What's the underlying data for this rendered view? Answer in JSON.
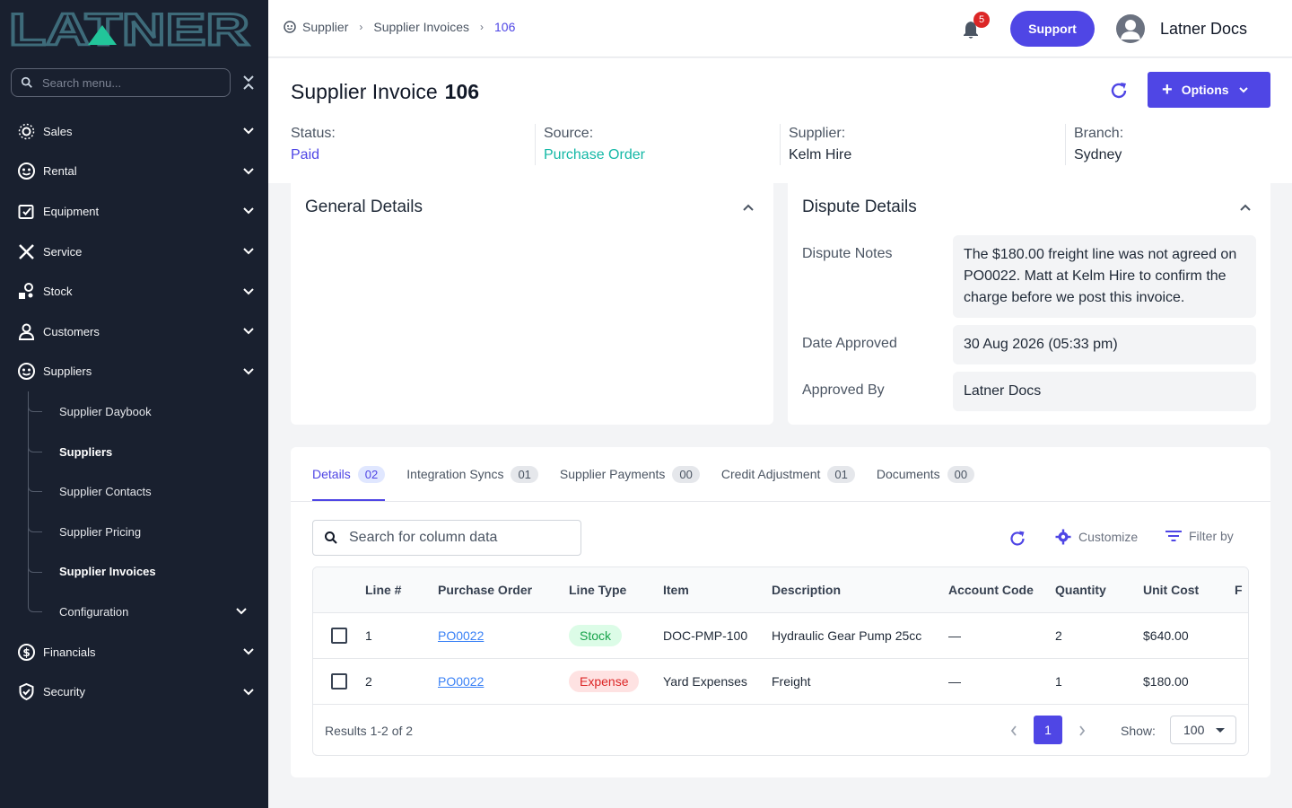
{
  "brand": {
    "logo_text": "LATNER"
  },
  "sidebar": {
    "search_placeholder": "Search menu...",
    "items": [
      {
        "label": "Sales",
        "icon": "sales-icon"
      },
      {
        "label": "Rental",
        "icon": "rental-icon"
      },
      {
        "label": "Equipment",
        "icon": "equipment-icon"
      },
      {
        "label": "Service",
        "icon": "service-icon"
      },
      {
        "label": "Stock",
        "icon": "stock-icon"
      },
      {
        "label": "Customers",
        "icon": "customers-icon"
      },
      {
        "label": "Suppliers",
        "icon": "suppliers-icon"
      },
      {
        "label": "Financials",
        "icon": "financials-icon"
      },
      {
        "label": "Security",
        "icon": "security-icon"
      }
    ],
    "supplier_subitems": [
      {
        "label": "Supplier Daybook",
        "active": false
      },
      {
        "label": "Suppliers",
        "active": true
      },
      {
        "label": "Supplier Contacts",
        "active": false
      },
      {
        "label": "Supplier Pricing",
        "active": false
      },
      {
        "label": "Supplier Invoices",
        "active": true
      },
      {
        "label": "Configuration",
        "active": false
      }
    ]
  },
  "topbar": {
    "breadcrumb": [
      "Supplier",
      "Supplier Invoices",
      "106"
    ],
    "notification_count": "5",
    "support_label": "Support",
    "user_name": "Latner Docs"
  },
  "header": {
    "title": "Supplier Invoice",
    "number": "106",
    "options_label": "Options",
    "meta": [
      {
        "label": "Status:",
        "value": "Paid"
      },
      {
        "label": "Source:",
        "value": "Purchase Order"
      },
      {
        "label": "Supplier:",
        "value": "Kelm Hire"
      },
      {
        "label": "Branch:",
        "value": "Sydney"
      }
    ]
  },
  "general_details": {
    "title": "General Details"
  },
  "dispute_details": {
    "title": "Dispute Details",
    "fields": [
      {
        "label": "Dispute Notes",
        "value": "The $180.00 freight line was not agreed on PO0022. Matt at Kelm Hire to confirm the charge before we post this invoice."
      },
      {
        "label": "Date Approved",
        "value": "30 Aug 2026 (05:33 pm)"
      },
      {
        "label": "Approved By",
        "value": "Latner Docs"
      }
    ]
  },
  "tabs": [
    {
      "label": "Details",
      "count": "02",
      "active": true
    },
    {
      "label": "Integration Syncs",
      "count": "01"
    },
    {
      "label": "Supplier Payments",
      "count": "00"
    },
    {
      "label": "Credit Adjustment",
      "count": "01"
    },
    {
      "label": "Documents",
      "count": "00"
    }
  ],
  "table_tools": {
    "search_placeholder": "Search for column data",
    "customize_label": "Customize",
    "filter_label": "Filter by"
  },
  "table": {
    "columns": [
      "Line #",
      "Purchase Order",
      "Line Type",
      "Item",
      "Description",
      "Account Code",
      "Quantity",
      "Unit Cost",
      "F"
    ],
    "rows": [
      {
        "line": "1",
        "po": "PO0022",
        "type": "Stock",
        "item": "DOC-PMP-100",
        "description": "Hydraulic Gear Pump 25cc",
        "account": "—",
        "qty": "2",
        "unit_cost": "$640.00"
      },
      {
        "line": "2",
        "po": "PO0022",
        "type": "Expense",
        "item": "Yard Expenses",
        "description": "Freight",
        "account": "—",
        "qty": "1",
        "unit_cost": "$180.00"
      }
    ],
    "results_text": "Results 1-2 of 2",
    "current_page": "1",
    "show_label": "Show:",
    "page_size": "100"
  },
  "colors": {
    "accent": "#4f46e5",
    "sidebar_bg": "#19202f",
    "source_teal": "#14b8a6"
  }
}
